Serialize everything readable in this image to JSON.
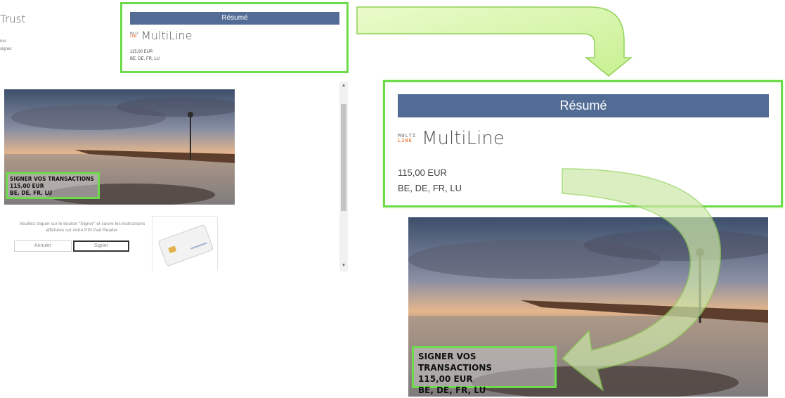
{
  "left_panel": {
    "brand_title": "Trust",
    "line1": "ner.",
    "line2": "signer."
  },
  "summary": {
    "header": "Résumé",
    "logo_mark_top": "MULTI",
    "logo_mark_bottom": "LINE",
    "logo_text": "MultiLine",
    "amount": "115,00 EUR",
    "countries": "BE, DE, FR, LU"
  },
  "photo_label": {
    "line1": "SIGNER VOS TRANSACTIONS",
    "line2": "115,00 EUR",
    "line3": "BE, DE, FR, LU"
  },
  "instructions": {
    "text": "Veuillez cliquer sur le bouton \"Signer\" et suivre les instructions affichées sur votre PIN Pad Reader."
  },
  "buttons": {
    "cancel": "Annuler",
    "sign": "Signer"
  },
  "scrollbar": {
    "up_glyph": "▲",
    "down_glyph": "▼"
  },
  "colors": {
    "highlight": "#6ddc4a",
    "header_bg": "#536c96",
    "logo_accent": "#ef7a3d"
  }
}
